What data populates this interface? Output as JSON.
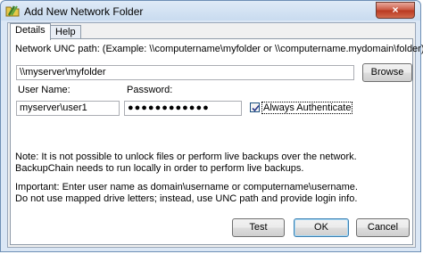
{
  "window": {
    "title": "Add New Network Folder",
    "close_label": "×"
  },
  "tabs": [
    {
      "label": "Details",
      "active": true
    },
    {
      "label": "Help",
      "active": false
    }
  ],
  "form": {
    "unc_label": "Network UNC path: (Example: \\\\computername\\myfolder or \\\\computername.mydomain\\folder)",
    "unc_value": "\\\\myserver\\myfolder",
    "browse_label": "Browse",
    "username_label": "User Name:",
    "username_value": "myserver\\user1",
    "password_label": "Password:",
    "password_value": "●●●●●●●●●●●●",
    "always_auth_label": "Always Authenticate",
    "always_auth_checked": true
  },
  "notes": {
    "note_line1": "Note: It is not possible to unlock files or perform live backups over the network.",
    "note_line2": "BackupChain needs to run locally in order to perform live backups.",
    "important_line1": "Important: Enter user name as domain\\username or computername\\username.",
    "important_line2": "Do not use mapped drive letters; instead, use UNC path and provide login info."
  },
  "buttons": {
    "test_label": "Test",
    "ok_label": "OK",
    "cancel_label": "Cancel"
  },
  "colors": {
    "title_bar": "#c9dbef",
    "close_button": "#c8553f",
    "panel_background": "#ffffff",
    "default_button_border": "#3c7fb1"
  },
  "icons": {
    "app": "network-folder-icon",
    "close": "close-icon",
    "checkbox": "checkmark-icon"
  }
}
